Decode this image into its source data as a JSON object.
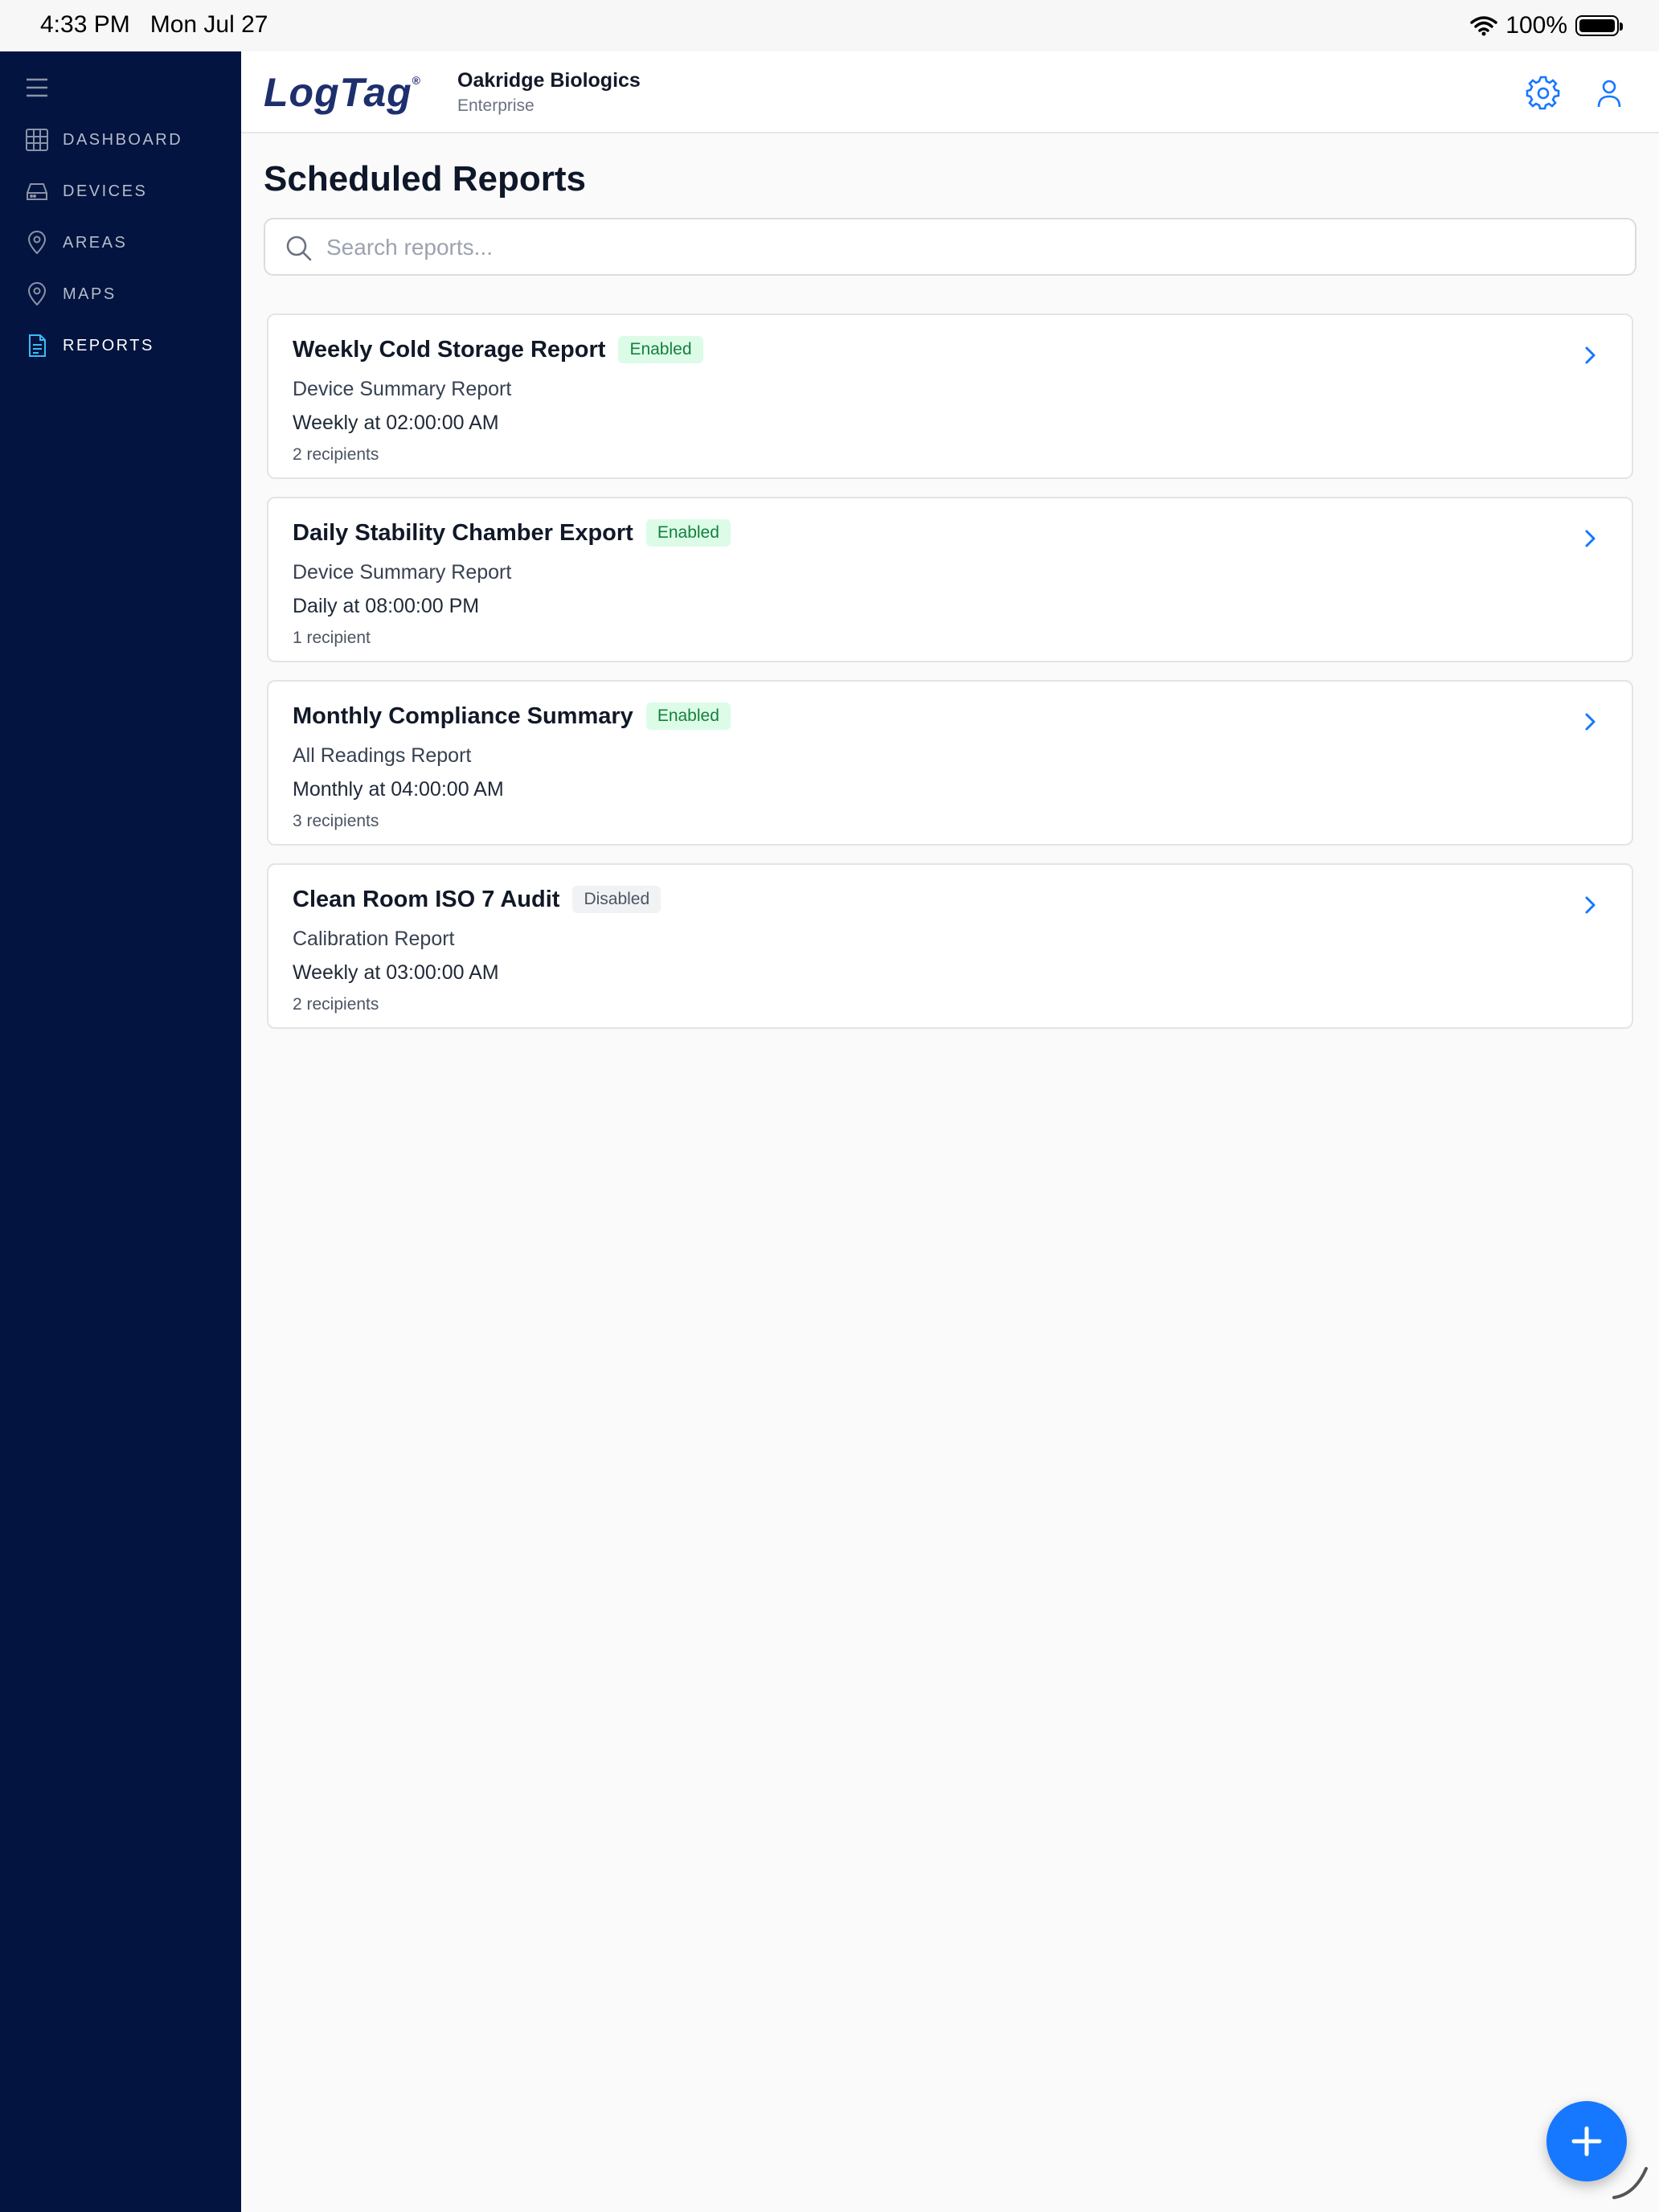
{
  "status_bar": {
    "time": "4:33 PM   Mon Jul 27",
    "battery": "100%"
  },
  "sidebar": {
    "items": [
      {
        "label": "DASHBOARD",
        "icon": "grid-icon"
      },
      {
        "label": "DEVICES",
        "icon": "device-icon"
      },
      {
        "label": "AREAS",
        "icon": "location-pin-icon"
      },
      {
        "label": "MAPS",
        "icon": "map-pin-icon"
      },
      {
        "label": "REPORTS",
        "icon": "document-icon",
        "active": true
      }
    ]
  },
  "header": {
    "logo": "LogTag",
    "logo_mark": "®",
    "org_name": "Oakridge Biologics",
    "org_type": "Enterprise"
  },
  "main": {
    "title": "Scheduled Reports",
    "search_placeholder": "Search reports...",
    "reports": [
      {
        "name": "Weekly Cold Storage Report",
        "status": "Enabled",
        "type": "Device Summary Report",
        "schedule": "Weekly at 02:00:00 AM",
        "recipients": "2 recipients"
      },
      {
        "name": "Daily Stability Chamber Export",
        "status": "Enabled",
        "type": "Device Summary Report",
        "schedule": "Daily at 08:00:00 PM",
        "recipients": "1 recipient"
      },
      {
        "name": "Monthly Compliance Summary",
        "status": "Enabled",
        "type": "All Readings Report",
        "schedule": "Monthly at 04:00:00 AM",
        "recipients": "3 recipients"
      },
      {
        "name": "Clean Room ISO 7 Audit",
        "status": "Disabled",
        "type": "Calibration Report",
        "schedule": "Weekly at 03:00:00 AM",
        "recipients": "2 recipients"
      }
    ]
  },
  "colors": {
    "sidebar_bg": "#02143f",
    "accent": "#1677ff",
    "enabled_bg": "#dcfce7",
    "enabled_text": "#15803d"
  }
}
